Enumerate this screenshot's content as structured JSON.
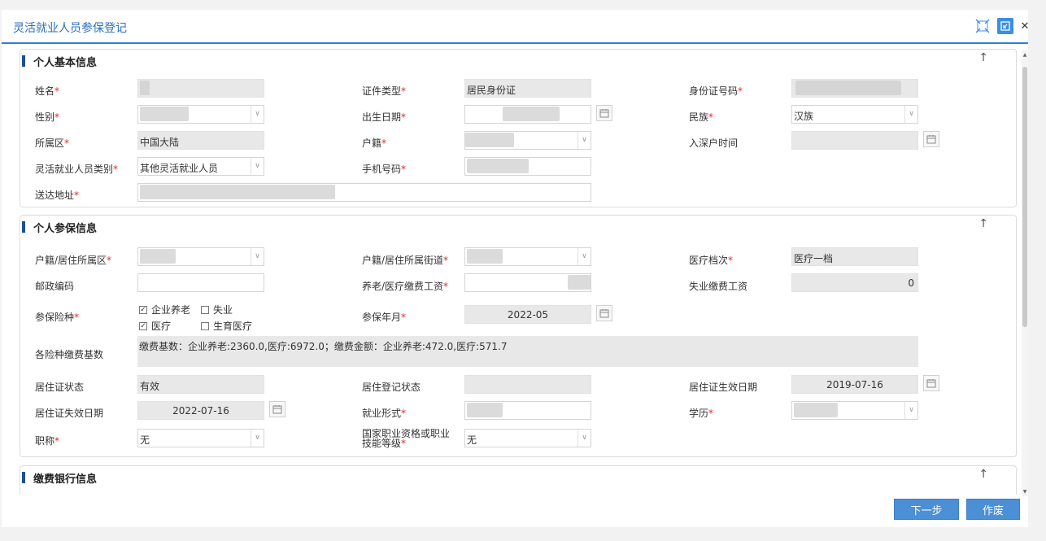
{
  "dialog": {
    "title": "灵活就业人员参保登记"
  },
  "basic": {
    "title": "个人基本信息",
    "name_label": "姓名",
    "idtype_label": "证件类型",
    "idtype_value": "居民身份证",
    "idno_label": "身份证号码",
    "gender_label": "性别",
    "birth_label": "出生日期",
    "ethnic_label": "民族",
    "ethnic_value": "汉族",
    "district_label": "所属区",
    "district_value": "中国大陆",
    "hukou_label": "户籍",
    "entry_label": "入深户时间",
    "category_label": "灵活就业人员类别",
    "category_value": "其他灵活就业人员",
    "phone_label": "手机号码",
    "address_label": "送达地址"
  },
  "insure": {
    "title": "个人参保信息",
    "res_district_label": "户籍/居住所属区",
    "res_street_label": "户籍/居住所属街道",
    "medical_tier_label": "医疗档次",
    "medical_tier_value": "医疗一档",
    "postal_label": "邮政编码",
    "pension_wage_label": "养老/医疗缴费工资",
    "unemp_wage_label": "失业缴费工资",
    "unemp_wage_value": "0",
    "types_label": "参保险种",
    "type_pension": "企业养老",
    "type_unemp": "失业",
    "type_medical": "医疗",
    "type_maternity": "生育医疗",
    "month_label": "参保年月",
    "month_value": "2022-05",
    "base_label": "各险种缴费基数",
    "base_value": "缴费基数：企业养老:2360.0,医疗:6972.0；缴费金额：企业养老:472.0,医疗:571.7",
    "res_status_label": "居住证状态",
    "res_status_value": "有效",
    "res_reg_label": "居住登记状态",
    "res_eff_label": "居住证生效日期",
    "res_eff_value": "2019-07-16",
    "res_exp_label": "居住证失效日期",
    "res_exp_value": "2022-07-16",
    "emp_form_label": "就业形式",
    "edu_label": "学历",
    "title_label": "职称",
    "title_value": "无",
    "qual_label": "国家职业资格或职业技能等级",
    "qual_value": "无"
  },
  "bank": {
    "title": "缴费银行信息"
  },
  "buttons": {
    "next": "下一步",
    "void": "作废"
  },
  "required_mark": "*",
  "icons": {
    "up": "↑",
    "close": "✕",
    "dropdown": "∨",
    "check": "✓"
  }
}
